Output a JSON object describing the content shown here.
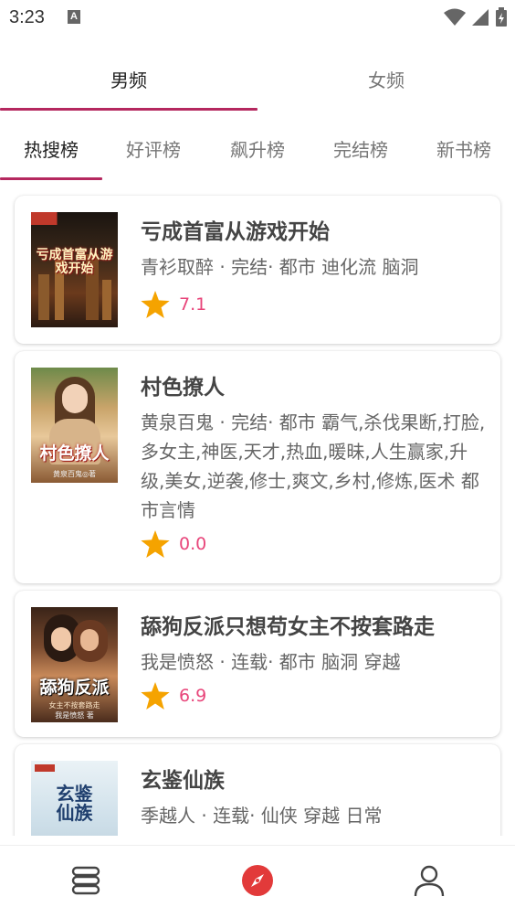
{
  "status_bar": {
    "time": "3:23",
    "notification_letter": "A"
  },
  "gender_tabs": [
    {
      "label": "男频",
      "active": true
    },
    {
      "label": "女频",
      "active": false
    }
  ],
  "rank_tabs": [
    {
      "label": "热搜榜",
      "active": true
    },
    {
      "label": "好评榜",
      "active": false
    },
    {
      "label": "飙升榜",
      "active": false
    },
    {
      "label": "完结榜",
      "active": false
    },
    {
      "label": "新书榜",
      "active": false
    }
  ],
  "books": [
    {
      "title": "亏成首富从游戏开始",
      "meta": "青衫取醉 · 完结· 都市 迪化流 脑洞",
      "rating": "7.1",
      "cover_text": "亏成首富从游戏开始"
    },
    {
      "title": "村色撩人",
      "meta": "黄泉百鬼 · 完结· 都市 霸气,杀伐果断,打脸,多女主,神医,天才,热血,暖昧,人生赢家,升级,美女,逆袭,修士,爽文,乡村,修炼,医术 都市言情",
      "rating": "0.0",
      "cover_text": "村色撩人",
      "cover_author": "黄泉百鬼◎著"
    },
    {
      "title": "舔狗反派只想苟女主不按套路走",
      "meta": "我是愤怒 · 连载· 都市 脑洞 穿越",
      "rating": "6.9",
      "cover_text": "舔狗反派",
      "cover_subtext": "女主不按套路走",
      "cover_author": "我是愤怒 著"
    },
    {
      "title": "玄鉴仙族",
      "meta": "季越人 · 连载· 仙侠 穿越 日常",
      "cover_text": "玄鉴仙族"
    }
  ],
  "colors": {
    "accent": "#b5285f",
    "rating": "#e8457a",
    "star": "#f5a300"
  },
  "bottom_nav": [
    {
      "icon": "bookshelf-icon"
    },
    {
      "icon": "compass-icon",
      "active": true
    },
    {
      "icon": "person-icon"
    }
  ]
}
